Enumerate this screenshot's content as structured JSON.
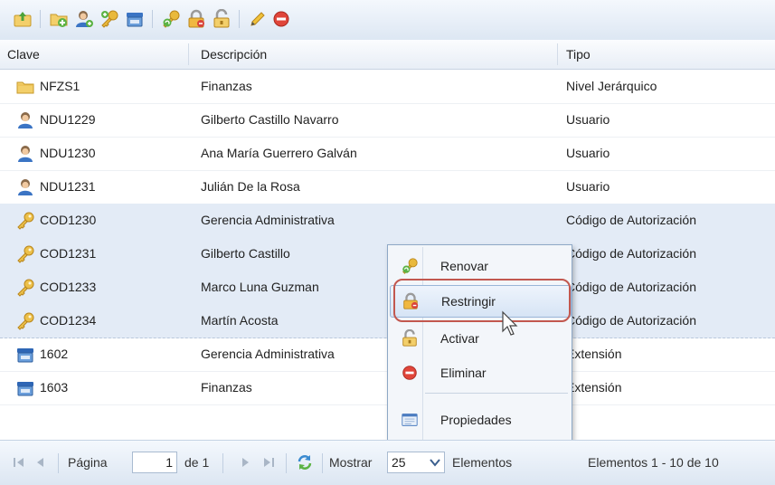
{
  "toolbar": {
    "buttons": [
      {
        "icon": "upload-folder-icon"
      },
      {
        "icon": "add-folder-icon"
      },
      {
        "icon": "add-user-icon"
      },
      {
        "icon": "add-key-icon"
      },
      {
        "icon": "add-extension-icon"
      },
      {
        "icon": "renew-key-icon"
      },
      {
        "icon": "lock-icon"
      },
      {
        "icon": "unlock-icon"
      },
      {
        "icon": "edit-pencil-icon"
      },
      {
        "icon": "delete-icon"
      }
    ]
  },
  "grid": {
    "columns": [
      "Clave",
      "Descripción",
      "Tipo"
    ],
    "rows": [
      {
        "icon": "folder-icon",
        "clave": "NFZS1",
        "descripcion": "Finanzas",
        "tipo": "Nivel Jerárquico",
        "selected": false
      },
      {
        "icon": "user-icon",
        "clave": "NDU1229",
        "descripcion": "Gilberto Castillo Navarro",
        "tipo": "Usuario",
        "selected": false
      },
      {
        "icon": "user-icon",
        "clave": "NDU1230",
        "descripcion": "Ana María Guerrero Galván",
        "tipo": "Usuario",
        "selected": false
      },
      {
        "icon": "user-icon",
        "clave": "NDU1231",
        "descripcion": "Julián De la Rosa",
        "tipo": "Usuario",
        "selected": false
      },
      {
        "icon": "key-icon",
        "clave": "COD1230",
        "descripcion": "Gerencia Administrativa",
        "tipo": "Código de Autorización",
        "selected": true
      },
      {
        "icon": "key-icon",
        "clave": "COD1231",
        "descripcion": "Gilberto Castillo",
        "tipo": "Código de Autorización",
        "selected": true
      },
      {
        "icon": "key-icon",
        "clave": "COD1233",
        "descripcion": "Marco Luna Guzman",
        "tipo": "Código de Autorización",
        "selected": true
      },
      {
        "icon": "key-icon",
        "clave": "COD1234",
        "descripcion": "Martín Acosta",
        "tipo": "Código de Autorización",
        "selected": true
      },
      {
        "icon": "phone-extension-icon",
        "clave": "1602",
        "descripcion": "Gerencia Administrativa",
        "tipo": "Extensión",
        "selected": false
      },
      {
        "icon": "phone-extension-icon",
        "clave": "1603",
        "descripcion": "Finanzas",
        "tipo": "Extensión",
        "selected": false
      }
    ]
  },
  "context_menu": {
    "items": [
      {
        "label": "Renovar",
        "icon": "renew-key-icon"
      },
      {
        "label": "Restringir",
        "icon": "lock-icon",
        "highlighted": true
      },
      {
        "label": "Activar",
        "icon": "unlock-icon"
      },
      {
        "label": "Eliminar",
        "icon": "delete-icon"
      },
      {
        "label": "Propiedades",
        "icon": "properties-icon"
      }
    ]
  },
  "pager": {
    "page_label": "Página",
    "page_value": "1",
    "of_label": "de 1",
    "show_label": "Mostrar",
    "page_size": "25",
    "elements_label": "Elementos",
    "summary": "Elementos 1 - 10 de 10"
  },
  "colors": {
    "highlight_ring": "#c2584f",
    "selected_row": "#e3ebf6",
    "toolbar_bg": "#dde7f3"
  }
}
